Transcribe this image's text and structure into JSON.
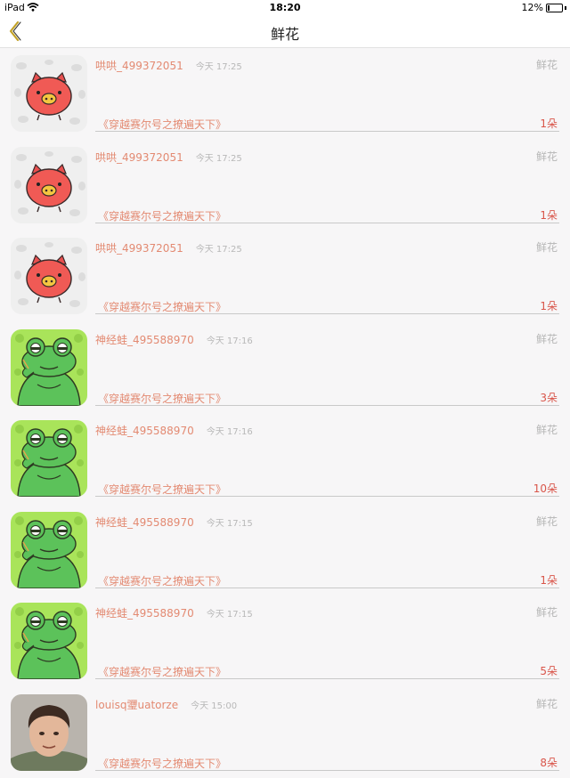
{
  "status_bar": {
    "device": "iPad",
    "time": "18:20",
    "battery": "12%",
    "battery_level": 0.12
  },
  "nav": {
    "title": "鲜花",
    "back_icon": "chevron-left-icon",
    "accent_color": "#c3a227"
  },
  "colors": {
    "username": "#e38a72",
    "count": "#d9554a",
    "muted": "#b6b6b6"
  },
  "rows": [
    {
      "avatar": "pig-avatar",
      "user": "哄哄_499372051",
      "time": "今天 17:25",
      "type": "鲜花",
      "book": "《穿越赛尔号之撩遍天下》",
      "count": "1朵"
    },
    {
      "avatar": "pig-avatar",
      "user": "哄哄_499372051",
      "time": "今天 17:25",
      "type": "鲜花",
      "book": "《穿越赛尔号之撩遍天下》",
      "count": "1朵"
    },
    {
      "avatar": "pig-avatar",
      "user": "哄哄_499372051",
      "time": "今天 17:25",
      "type": "鲜花",
      "book": "《穿越赛尔号之撩遍天下》",
      "count": "1朵"
    },
    {
      "avatar": "frog-avatar",
      "user": "神经蛙_495588970",
      "time": "今天 17:16",
      "type": "鲜花",
      "book": "《穿越赛尔号之撩遍天下》",
      "count": "3朵"
    },
    {
      "avatar": "frog-avatar",
      "user": "神经蛙_495588970",
      "time": "今天 17:16",
      "type": "鲜花",
      "book": "《穿越赛尔号之撩遍天下》",
      "count": "10朵"
    },
    {
      "avatar": "frog-avatar",
      "user": "神经蛙_495588970",
      "time": "今天 17:15",
      "type": "鲜花",
      "book": "《穿越赛尔号之撩遍天下》",
      "count": "1朵"
    },
    {
      "avatar": "frog-avatar",
      "user": "神经蛙_495588970",
      "time": "今天 17:15",
      "type": "鲜花",
      "book": "《穿越赛尔号之撩遍天下》",
      "count": "5朵"
    },
    {
      "avatar": "boy-photo-avatar",
      "user": "louisq瓕uatorze",
      "time": "今天 15:00",
      "type": "鲜花",
      "book": "《穿越赛尔号之撩遍天下》",
      "count": "8朵"
    }
  ]
}
